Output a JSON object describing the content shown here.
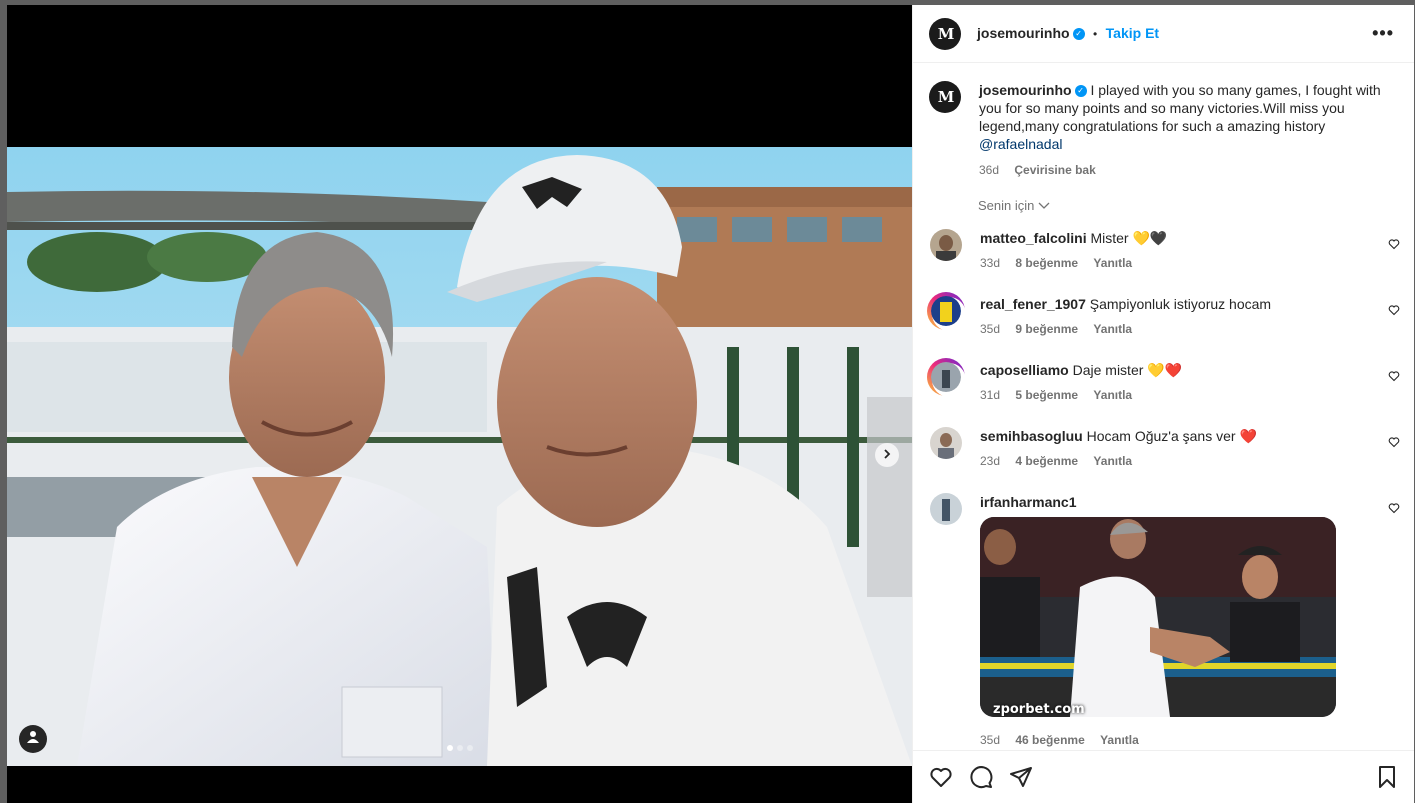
{
  "post": {
    "author": "josemourinho",
    "follow_label": "Takip Et",
    "dot": "•",
    "caption": "I played with you so many games, I fought with you for so many points and so many victories.Will miss you legend,many congratulations for such a amazing history",
    "mention": "@rafaelnadal",
    "time": "36d",
    "translate_label": "Çevirisine bak",
    "filter_label": "Senin için",
    "carousel_count": 3,
    "carousel_active": 1
  },
  "comments": [
    {
      "user": "matteo_falcolini",
      "text": "Mister",
      "emoji": "💛🖤",
      "time": "33d",
      "likes": "8 beğenme",
      "reply": "Yanıtla"
    },
    {
      "user": "real_fener_1907",
      "text": "Şampiyonluk istiyoruz hocam",
      "emoji": "",
      "time": "35d",
      "likes": "9 beğenme",
      "reply": "Yanıtla"
    },
    {
      "user": "caposelliamo",
      "text": "Daje mister",
      "emoji": "💛❤️",
      "time": "31d",
      "likes": "5 beğenme",
      "reply": "Yanıtla"
    },
    {
      "user": "semihbasogluu",
      "text": "Hocam Oğuz'a şans ver",
      "emoji": "❤️",
      "time": "23d",
      "likes": "4 beğenme",
      "reply": "Yanıtla"
    },
    {
      "user": "irfanharmanc1",
      "text": "",
      "emoji": "",
      "time": "35d",
      "likes": "46 beğenme",
      "reply": "Yanıtla",
      "gif_watermark": "zporbet.com"
    }
  ],
  "colors": {
    "accent": "#0095f6",
    "text": "#262626",
    "muted": "#737373",
    "heart": "#ed4956"
  },
  "icons": [
    "heart-icon",
    "comment-icon",
    "share-icon",
    "bookmark-icon",
    "more-icon",
    "tag-user-icon",
    "chevron-right-icon"
  ]
}
